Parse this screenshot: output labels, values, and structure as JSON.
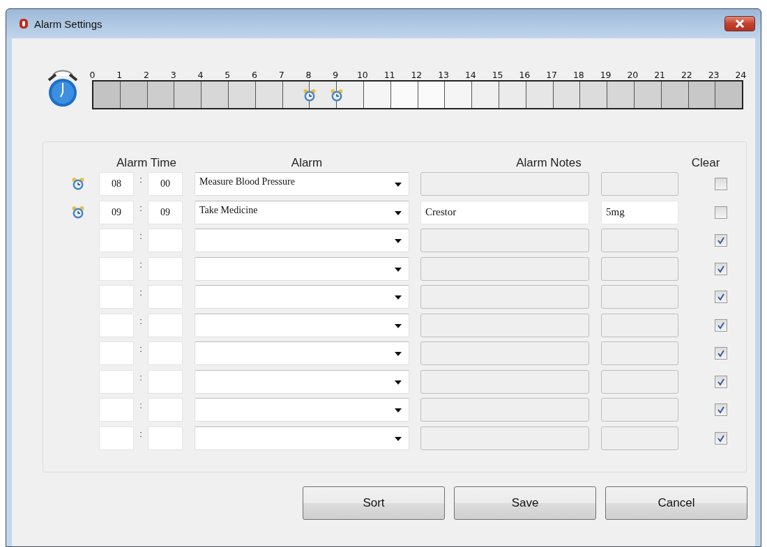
{
  "window": {
    "title": "Alarm Settings"
  },
  "timeline": {
    "hours": [
      "0",
      "1",
      "2",
      "3",
      "4",
      "5",
      "6",
      "7",
      "8",
      "9",
      "10",
      "11",
      "12",
      "13",
      "14",
      "15",
      "16",
      "17",
      "18",
      "19",
      "20",
      "21",
      "22",
      "23",
      "24"
    ]
  },
  "columns": [
    "Alarm Time",
    "Alarm",
    "Alarm Notes",
    "Clear"
  ],
  "time_separator": [
    ":",
    ":",
    ":",
    ":",
    ":",
    ":",
    ":",
    ":",
    ":",
    ":"
  ],
  "rows": [
    {
      "alarm_set": true,
      "hour": "08",
      "minute": "00",
      "alarm": "Measure Blood Pressure",
      "note": "",
      "dose": "",
      "notes_disabled": true,
      "clear": false
    },
    {
      "alarm_set": true,
      "hour": "09",
      "minute": "09",
      "alarm": "Take Medicine",
      "note": "Crestor",
      "dose": "5mg",
      "notes_disabled": false,
      "clear": false
    },
    {
      "alarm_set": false,
      "hour": "",
      "minute": "",
      "alarm": "",
      "note": "",
      "dose": "",
      "notes_disabled": true,
      "clear": true
    },
    {
      "alarm_set": false,
      "hour": "",
      "minute": "",
      "alarm": "",
      "note": "",
      "dose": "",
      "notes_disabled": true,
      "clear": true
    },
    {
      "alarm_set": false,
      "hour": "",
      "minute": "",
      "alarm": "",
      "note": "",
      "dose": "",
      "notes_disabled": true,
      "clear": true
    },
    {
      "alarm_set": false,
      "hour": "",
      "minute": "",
      "alarm": "",
      "note": "",
      "dose": "",
      "notes_disabled": true,
      "clear": true
    },
    {
      "alarm_set": false,
      "hour": "",
      "minute": "",
      "alarm": "",
      "note": "",
      "dose": "",
      "notes_disabled": true,
      "clear": true
    },
    {
      "alarm_set": false,
      "hour": "",
      "minute": "",
      "alarm": "",
      "note": "",
      "dose": "",
      "notes_disabled": true,
      "clear": true
    },
    {
      "alarm_set": false,
      "hour": "",
      "minute": "",
      "alarm": "",
      "note": "",
      "dose": "",
      "notes_disabled": true,
      "clear": true
    },
    {
      "alarm_set": false,
      "hour": "",
      "minute": "",
      "alarm": "",
      "note": "",
      "dose": "",
      "notes_disabled": true,
      "clear": true
    }
  ],
  "buttons": [
    "Sort",
    "Save",
    "Cancel"
  ]
}
